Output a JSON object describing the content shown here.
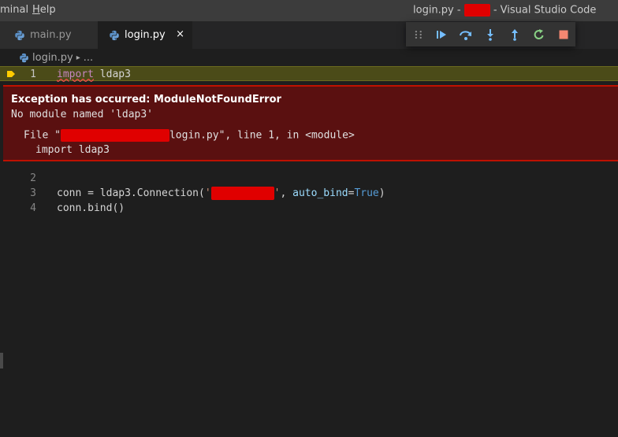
{
  "titlebar": {
    "menu": [
      {
        "label": "minal",
        "mnemonic": ""
      },
      {
        "label": "elp",
        "mnemonic": "H"
      }
    ],
    "title_prefix": "login.py - ",
    "title_suffix": " - Visual Studio Code"
  },
  "tabs": [
    {
      "label": "main.py",
      "active": false
    },
    {
      "label": "login.py",
      "active": true,
      "close": "×"
    }
  ],
  "debug_toolbar": {
    "buttons": [
      {
        "name": "continue-icon",
        "color": "#75beff"
      },
      {
        "name": "step-over-icon",
        "color": "#75beff"
      },
      {
        "name": "step-into-icon",
        "color": "#75beff"
      },
      {
        "name": "step-out-icon",
        "color": "#75beff"
      },
      {
        "name": "restart-icon",
        "color": "#89d185"
      },
      {
        "name": "stop-icon",
        "color": "#f48771"
      }
    ]
  },
  "breadcrumb": {
    "file": "login.py",
    "more": "..."
  },
  "editor": {
    "lines": [
      {
        "number": "1",
        "keyword": "import",
        "rest": " ldap3"
      },
      {
        "number": "2"
      },
      {
        "number": "3",
        "pre": "conn = ldap3.Connection(",
        "str_open": "'",
        "str_close": "'",
        "mid": ", ",
        "param": "auto_bind",
        "eq": "=",
        "const": "True",
        "post": ")"
      },
      {
        "number": "4",
        "text": "conn.bind()"
      }
    ]
  },
  "exception": {
    "title": "Exception has occurred: ModuleNotFoundError",
    "message": "No module named 'ldap3'",
    "trace_prefix": "File \"",
    "trace_suffix": "login.py\", line 1, in <module>",
    "trace_code": "import ldap3"
  },
  "colors": {
    "accent_current_line": "#4b4b18",
    "exception_bg": "#5a1010",
    "exception_border": "#be1100",
    "redaction": "#e00000"
  }
}
